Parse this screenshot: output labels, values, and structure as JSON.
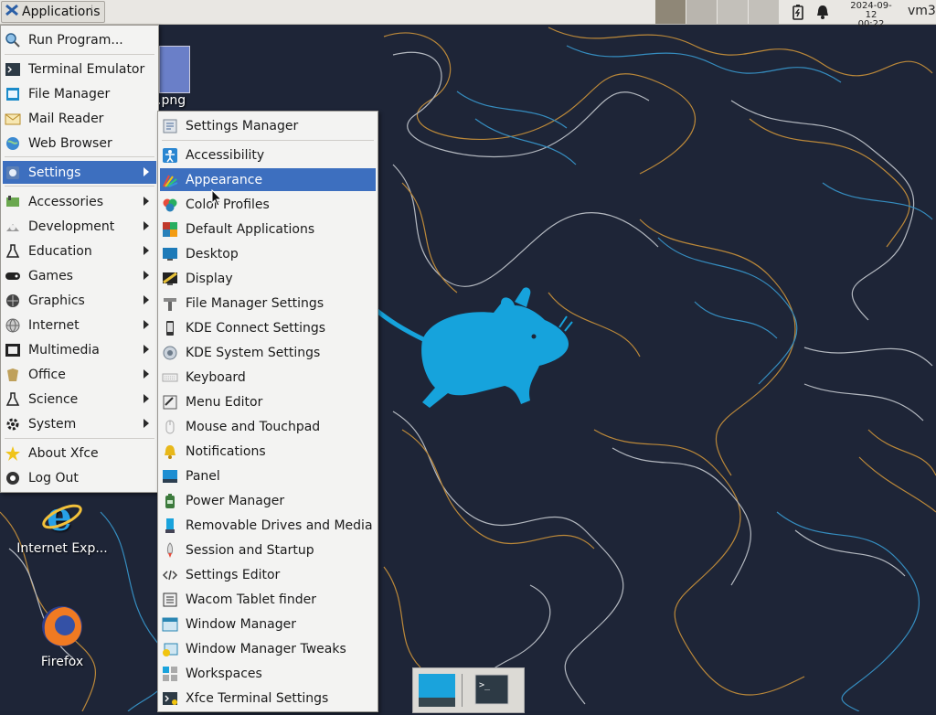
{
  "top_panel": {
    "applications_label": "Applications",
    "clock_date": "2024-09-12",
    "clock_time": "00:22",
    "user": "vm3"
  },
  "desktop": {
    "icons": [
      {
        "label": ".png"
      },
      {
        "label": "Internet Exp..."
      },
      {
        "label": "Firefox"
      }
    ]
  },
  "app_menu": {
    "items": [
      {
        "label": "Run Program...",
        "icon": "search-icon"
      },
      {
        "label": "Terminal Emulator",
        "icon": "terminal-icon"
      },
      {
        "label": "File Manager",
        "icon": "file-manager-icon"
      },
      {
        "label": "Mail Reader",
        "icon": "mail-icon"
      },
      {
        "label": "Web Browser",
        "icon": "globe-icon"
      },
      {
        "label": "Settings",
        "icon": "settings-icon",
        "submenu": true,
        "selected": true
      },
      {
        "label": "Accessories",
        "icon": "accessories-icon",
        "submenu": true
      },
      {
        "label": "Development",
        "icon": "development-icon",
        "submenu": true
      },
      {
        "label": "Education",
        "icon": "flask-icon",
        "submenu": true
      },
      {
        "label": "Games",
        "icon": "gamepad-icon",
        "submenu": true
      },
      {
        "label": "Graphics",
        "icon": "graphics-icon",
        "submenu": true
      },
      {
        "label": "Internet",
        "icon": "internet-icon",
        "submenu": true
      },
      {
        "label": "Multimedia",
        "icon": "multimedia-icon",
        "submenu": true
      },
      {
        "label": "Office",
        "icon": "office-icon",
        "submenu": true
      },
      {
        "label": "Science",
        "icon": "science-icon",
        "submenu": true
      },
      {
        "label": "System",
        "icon": "gear-icon",
        "submenu": true
      },
      {
        "label": "About Xfce",
        "icon": "star-icon"
      },
      {
        "label": "Log Out",
        "icon": "logout-icon"
      }
    ]
  },
  "settings_menu": {
    "items": [
      {
        "label": "Settings Manager",
        "icon": "settings-manager-icon"
      },
      {
        "label": "Accessibility",
        "icon": "accessibility-icon"
      },
      {
        "label": "Appearance",
        "icon": "appearance-icon",
        "selected": true
      },
      {
        "label": "Color Profiles",
        "icon": "color-profiles-icon"
      },
      {
        "label": "Default Applications",
        "icon": "default-apps-icon"
      },
      {
        "label": "Desktop",
        "icon": "desktop-icon"
      },
      {
        "label": "Display",
        "icon": "display-icon"
      },
      {
        "label": "File Manager Settings",
        "icon": "file-manager-settings-icon"
      },
      {
        "label": "KDE Connect Settings",
        "icon": "phone-icon"
      },
      {
        "label": "KDE System Settings",
        "icon": "kde-settings-icon"
      },
      {
        "label": "Keyboard",
        "icon": "keyboard-icon"
      },
      {
        "label": "Menu Editor",
        "icon": "menu-editor-icon"
      },
      {
        "label": "Mouse and Touchpad",
        "icon": "mouse-icon"
      },
      {
        "label": "Notifications",
        "icon": "bell-icon"
      },
      {
        "label": "Panel",
        "icon": "panel-icon"
      },
      {
        "label": "Power Manager",
        "icon": "battery-icon"
      },
      {
        "label": "Removable Drives and Media",
        "icon": "usb-drive-icon"
      },
      {
        "label": "Session and Startup",
        "icon": "rocket-icon"
      },
      {
        "label": "Settings Editor",
        "icon": "code-icon"
      },
      {
        "label": "Wacom Tablet finder",
        "icon": "tablet-icon"
      },
      {
        "label": "Window Manager",
        "icon": "window-manager-icon"
      },
      {
        "label": "Window Manager Tweaks",
        "icon": "window-tweaks-icon"
      },
      {
        "label": "Workspaces",
        "icon": "workspaces-icon"
      },
      {
        "label": "Xfce Terminal Settings",
        "icon": "terminal-settings-icon"
      }
    ]
  },
  "colors": {
    "selection": "#3d6fbf",
    "mouse_logo": "#16a3dc",
    "desktop_bg": "#1d2436"
  }
}
